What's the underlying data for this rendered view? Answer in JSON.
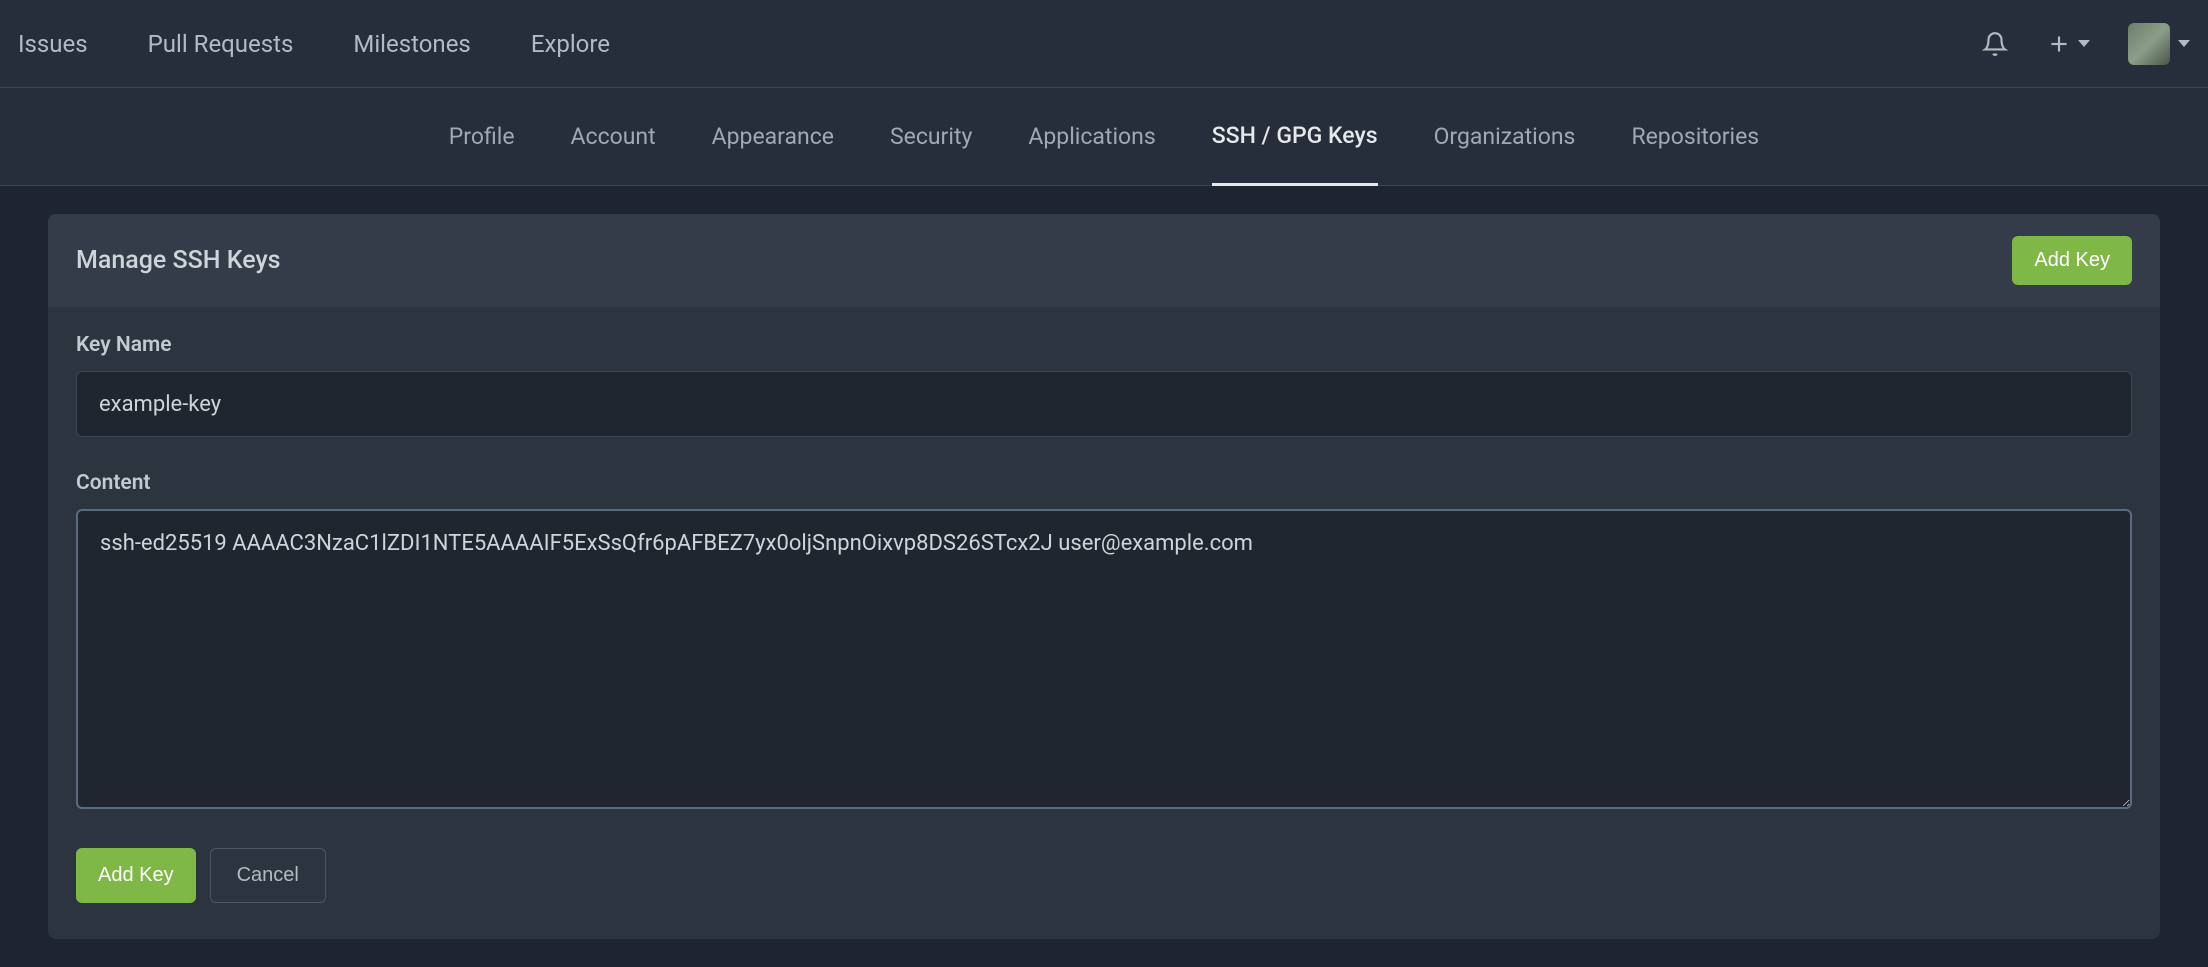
{
  "topnav": {
    "issues": "Issues",
    "pull_requests": "Pull Requests",
    "milestones": "Milestones",
    "explore": "Explore"
  },
  "settings_tabs": {
    "profile": "Profile",
    "account": "Account",
    "appearance": "Appearance",
    "security": "Security",
    "applications": "Applications",
    "ssh_gpg": "SSH / GPG Keys",
    "organizations": "Organizations",
    "repositories": "Repositories"
  },
  "panel": {
    "title": "Manage SSH Keys",
    "header_add_key": "Add Key"
  },
  "form": {
    "key_name_label": "Key Name",
    "key_name_value": "example-key",
    "content_label": "Content",
    "content_value": "ssh-ed25519 AAAAC3NzaC1lZDI1NTE5AAAAIF5ExSsQfr6pAFBEZ7yx0oljSnpnOixvp8DS26STcx2J user@example.com",
    "submit_label": "Add Key",
    "cancel_label": "Cancel"
  }
}
